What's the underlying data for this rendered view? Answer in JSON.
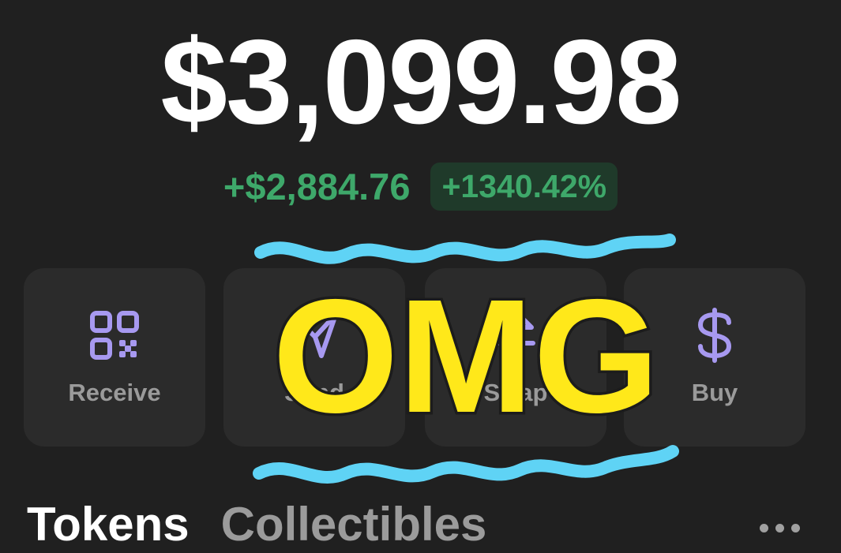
{
  "balance": {
    "total": "$3,099.98",
    "change_amount": "+$2,884.76",
    "change_percent": "+1340.42%"
  },
  "actions": [
    {
      "label": "Receive",
      "icon": "qr-code-icon"
    },
    {
      "label": "Send",
      "icon": "send-arrow-icon"
    },
    {
      "label": "Swap",
      "icon": "swap-icon"
    },
    {
      "label": "Buy",
      "icon": "dollar-icon"
    }
  ],
  "overlay": {
    "text": "OMG",
    "text_color": "#ffe81a",
    "squiggle_color": "#5fd3f5"
  },
  "tabs": [
    {
      "label": "Tokens",
      "active": true
    },
    {
      "label": "Collectibles",
      "active": false
    }
  ],
  "colors": {
    "background": "#202020",
    "positive": "#3ea86a",
    "icon_accent": "#a799f0",
    "card": "#2b2b2b"
  },
  "more_icon": "ellipsis-icon"
}
